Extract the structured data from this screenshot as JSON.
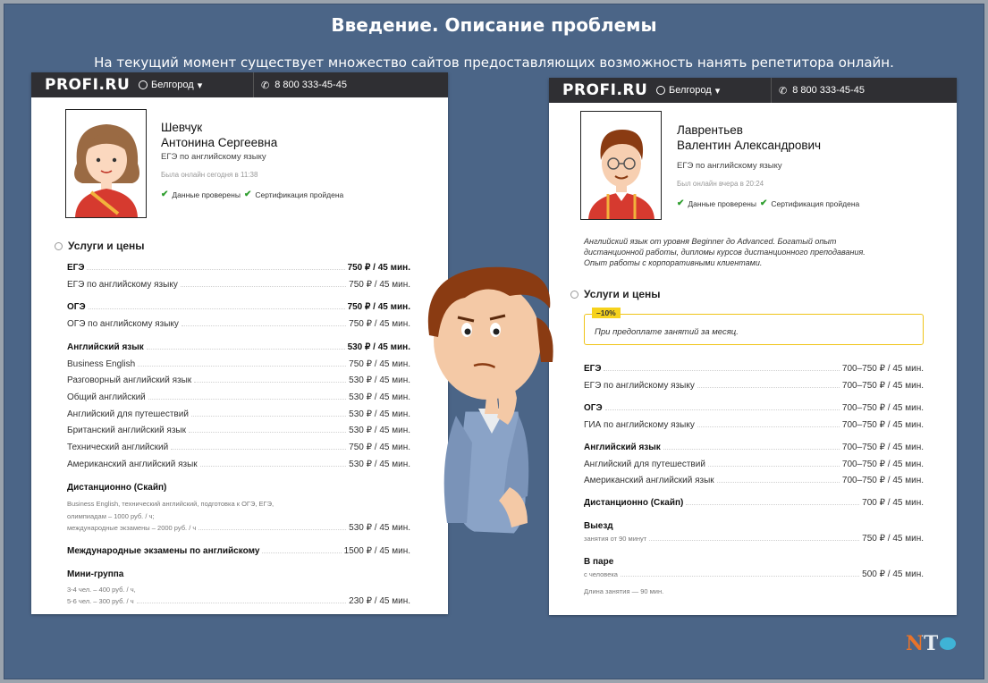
{
  "slide": {
    "title": "Введение. Описание проблемы",
    "subtitle": "На текущий момент существует множество сайтов предоставляющих возможность нанять репетитора онлайн."
  },
  "colors": {
    "background": "#4b6587",
    "bar": "#2f2f33",
    "accent": "#f6d21c",
    "check": "#2e9e2e"
  },
  "left": {
    "logo": "PROFI.RU",
    "city": "Белгород",
    "phone": "8 800 333-45-45",
    "name1": "Шевчук",
    "name2": "Антонина Сергеевна",
    "subject": "ЕГЭ по английскому языку",
    "online": "Была онлайн сегодня в 11:38",
    "verif1": "Данные проверены",
    "verif2": "Сертификация пройдена",
    "section": "Услуги и цены",
    "rows": [
      {
        "label": "ЕГЭ",
        "price": "750 ₽ / 45 мин."
      },
      {
        "label": "ЕГЭ по английскому языку",
        "price": "750 ₽ / 45 мин."
      },
      {
        "label": "ОГЭ",
        "price": "750 ₽ / 45 мин."
      },
      {
        "label": "ОГЭ по английскому языку",
        "price": "750 ₽ / 45 мин."
      },
      {
        "label": "Английский язык",
        "price": "530 ₽ / 45 мин."
      },
      {
        "label": "Business English",
        "price": "750 ₽ / 45 мин."
      },
      {
        "label": "Разговорный английский язык",
        "price": "530 ₽ / 45 мин."
      },
      {
        "label": "Общий английский",
        "price": "530 ₽ / 45 мин."
      },
      {
        "label": "Английский для путешествий",
        "price": "530 ₽ / 45 мин."
      },
      {
        "label": "Британский английский язык",
        "price": "530 ₽ / 45 мин."
      },
      {
        "label": "Технический английский",
        "price": "750 ₽ / 45 мин."
      },
      {
        "label": "Американский английский язык",
        "price": "530 ₽ / 45 мин."
      },
      {
        "label": "Дистанционно (Скайп)",
        "price": ""
      },
      {
        "label": "международные экзамены – 2000 руб. / ч",
        "price": "530 ₽ / 45 мин."
      },
      {
        "label": "Международные экзамены по английскому",
        "price": "1500 ₽ / 45 мин."
      },
      {
        "label": "Мини-группа",
        "price": ""
      },
      {
        "label": "5-6 чел. – 300 руб. / ч",
        "price": "230 ₽ / 45 мин."
      }
    ],
    "note1": "Business English, технический английский, подготовка к ОГЭ, ЕГЭ,",
    "note2": "олимпиадам – 1000 руб. / ч;",
    "note3": "3-4 чел. – 400 руб. / ч,"
  },
  "right": {
    "logo": "PROFI.RU",
    "city": "Белгород",
    "phone": "8 800 333-45-45",
    "name1": "Лаврентьев",
    "name2": "Валентин Александрович",
    "subject": "ЕГЭ по английскому языку",
    "online": "Был онлайн вчера в 20:24",
    "verif1": "Данные проверены",
    "verif2": "Сертификация пройдена",
    "about1": "Английский язык от уровня Beginner до Advanced. Богатый опыт",
    "about2": "дистанционной работы, дипломы курсов дистанционного преподавания.",
    "about3": "Опыт работы с корпоративными клиентами.",
    "section": "Услуги и цены",
    "discount": "–10%",
    "promo": "При предоплате занятий за месяц.",
    "rows": [
      {
        "label": "ЕГЭ",
        "price": "700–750 ₽ / 45 мин."
      },
      {
        "label": "ЕГЭ по английскому языку",
        "price": "700–750 ₽ / 45 мин."
      },
      {
        "label": "ОГЭ",
        "price": "700–750 ₽ / 45 мин."
      },
      {
        "label": "ГИА по английскому языку",
        "price": "700–750 ₽ / 45 мин."
      },
      {
        "label": "Английский язык",
        "price": "700–750 ₽ / 45 мин."
      },
      {
        "label": "Английский для путешествий",
        "price": "700–750 ₽ / 45 мин."
      },
      {
        "label": "Американский английский язык",
        "price": "700–750 ₽ / 45 мин."
      },
      {
        "label": "Дистанционно (Скайп)",
        "price": "700 ₽ / 45 мин."
      },
      {
        "label": "Выезд",
        "price": ""
      },
      {
        "label": "занятия от 90 минут",
        "price": "750 ₽ / 45 мин."
      },
      {
        "label": "В паре",
        "price": ""
      },
      {
        "label": "с человека",
        "price": "500 ₽ / 45 мин."
      }
    ],
    "duration": "Длина занятия — 90 мин."
  },
  "brand": {
    "letters": "NT"
  }
}
